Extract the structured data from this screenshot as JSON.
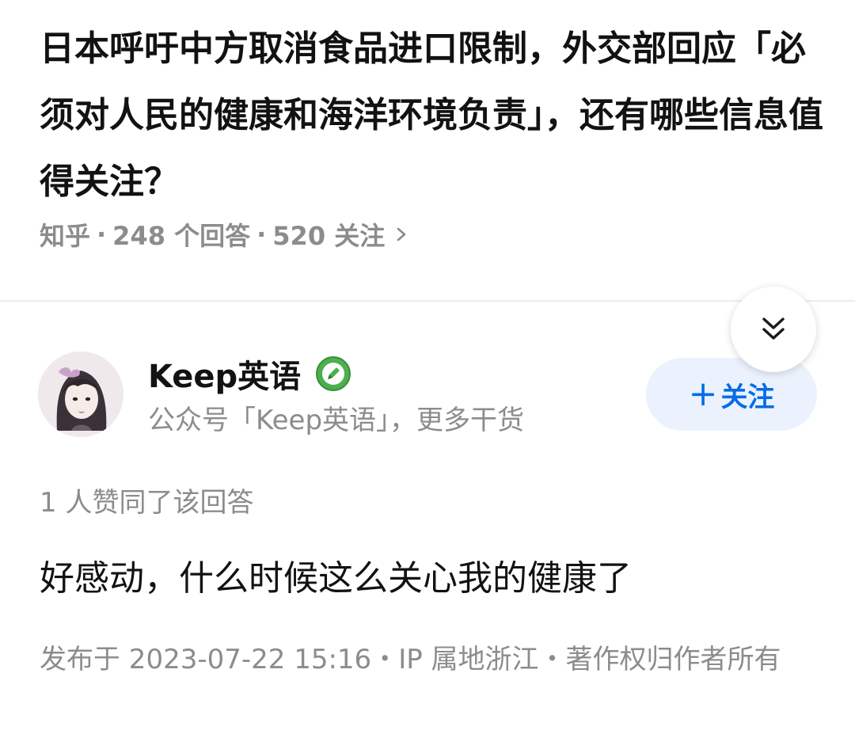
{
  "question": {
    "title": "日本呼吁中方取消食品进口限制，外交部回应「必须对人民的健康和海洋环境负责」，还有哪些信息值得关注？",
    "source": "知乎",
    "separator": "·",
    "answers_count": "248 个回答",
    "followers_count": "520 关注"
  },
  "answer": {
    "author_name": "Keep英语",
    "author_bio": "公众号「Keep英语」，更多干货",
    "follow_plus": "+",
    "follow_label": "关注",
    "votes": "1 人赞同了该回答",
    "content": "好感动，什么时候这么关心我的健康了",
    "publish_info": "发布于 2023-07-22 15:16・IP 属地浙江・著作权归作者所有"
  },
  "icons": {
    "collapse": "double-chevron-down-icon",
    "meta_arrow": "chevron-right-icon",
    "verified": "pencil-badge-icon",
    "avatar": "avatar-illustration"
  },
  "colors": {
    "accent": "#056de8",
    "follow_bg": "#ebf2fd",
    "badge_green": "#4caf50",
    "muted": "#8c8c8c",
    "text": "#121212"
  }
}
